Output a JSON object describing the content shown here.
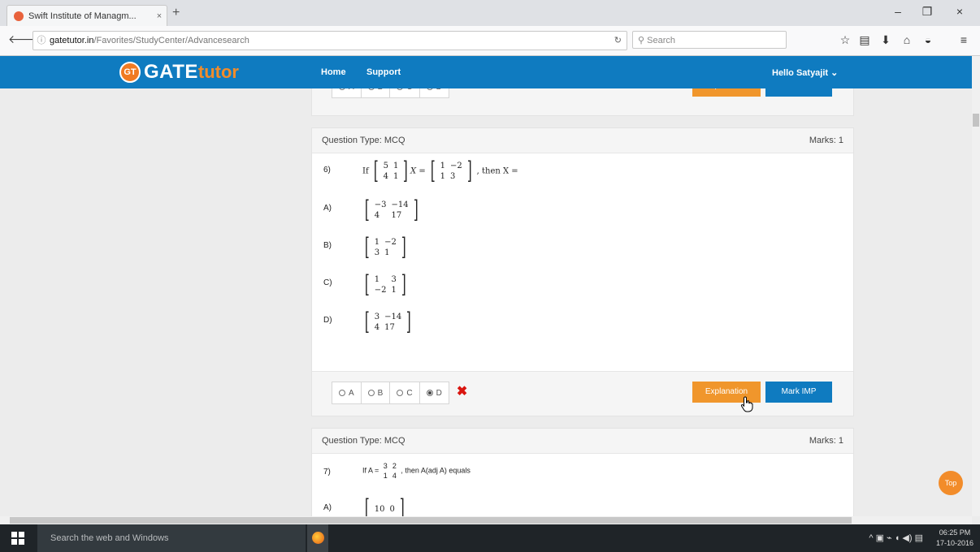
{
  "browser": {
    "tab_title": "Swift Institute of Managm...",
    "tab_close": "×",
    "new_tab": "+",
    "url_domain": "gatetutor.in",
    "url_path": "/Favorites/StudyCenter/Advancesearch",
    "search_placeholder": "Search",
    "window_min": "–",
    "window_restore": "❐",
    "window_close": "×"
  },
  "site": {
    "logo_badge": "GT",
    "logo_gate": "GATE",
    "logo_tutor": "tutor",
    "nav": {
      "home": "Home",
      "support": "Support",
      "user": "Hello Satyajit ⌄"
    }
  },
  "prev_card": {
    "options": [
      "A",
      "B",
      "C",
      "D"
    ],
    "explanation_label": "Explanation",
    "mark_imp_label": "Mark IMP"
  },
  "q6": {
    "type_label": "Question Type: MCQ",
    "marks_label": "Marks: 1",
    "number": "6)",
    "stem_prefix": "If",
    "stem_suffix": ", then X =",
    "stem_matrix_a": [
      [
        "5",
        "1"
      ],
      [
        "4",
        "1"
      ]
    ],
    "stem_matrix_b": [
      [
        "1",
        "−2"
      ],
      [
        "1",
        "3"
      ]
    ],
    "choices": [
      {
        "label": "A)",
        "matrix": [
          [
            "−3",
            "−14"
          ],
          [
            "4",
            "17"
          ]
        ]
      },
      {
        "label": "B)",
        "matrix": [
          [
            "1",
            "−2"
          ],
          [
            "3",
            "1"
          ]
        ]
      },
      {
        "label": "C)",
        "matrix": [
          [
            "1",
            "3"
          ],
          [
            "−2",
            "1"
          ]
        ]
      },
      {
        "label": "D)",
        "matrix": [
          [
            "3",
            "−14"
          ],
          [
            "4",
            "17"
          ]
        ]
      }
    ],
    "options": [
      "A",
      "B",
      "C",
      "D"
    ],
    "selected": "D",
    "wrong_mark": "✖",
    "explanation_label": "Explanation",
    "mark_imp_label": "Mark IMP"
  },
  "q7": {
    "type_label": "Question Type: MCQ",
    "marks_label": "Marks: 1",
    "number": "7)",
    "stem_prefix": "If A =",
    "stem_suffix": ", then A(adj A) equals",
    "stem_matrix": [
      [
        "3",
        "2"
      ],
      [
        "1",
        "4"
      ]
    ],
    "choice_a_label": "A)",
    "choice_a_partial": [
      [
        "10",
        "0"
      ]
    ]
  },
  "top_button": "Top",
  "taskbar": {
    "search_placeholder": "Search the web and Windows",
    "time": "06:25 PM",
    "date": "17-10-2016"
  }
}
